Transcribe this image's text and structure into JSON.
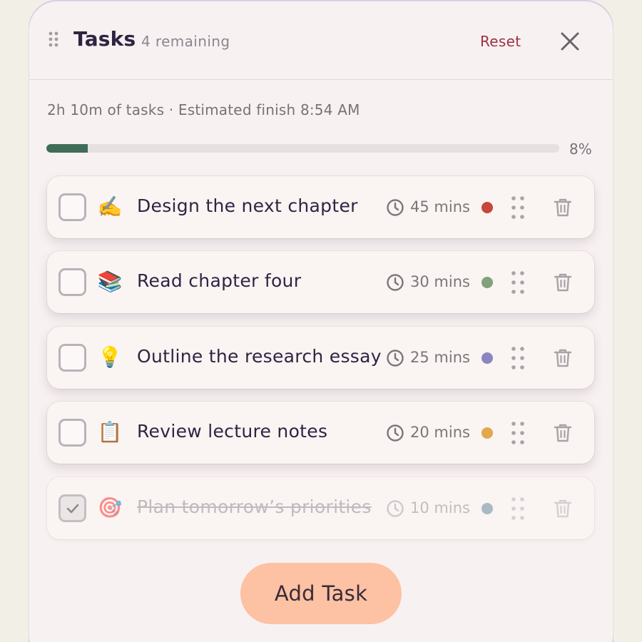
{
  "header": {
    "title": "Tasks",
    "remaining": "4 remaining",
    "reset_label": "Reset"
  },
  "summary": {
    "text": "2h 10m of tasks · Estimated finish 8:54 AM"
  },
  "progress": {
    "percent": 8,
    "label": "8%",
    "color": "#3f6d58"
  },
  "tasks": [
    {
      "emoji": "✍️",
      "name": "Design the next chapter",
      "duration": "45 mins",
      "color": "#c6473b",
      "done": false
    },
    {
      "emoji": "📚",
      "name": "Read chapter four",
      "duration": "30 mins",
      "color": "#82a07a",
      "done": false
    },
    {
      "emoji": "💡",
      "name": "Outline the research essay",
      "duration": "25 mins",
      "color": "#8a86bf",
      "done": false
    },
    {
      "emoji": "📋",
      "name": "Review lecture notes",
      "duration": "20 mins",
      "color": "#e2a84a",
      "done": false
    },
    {
      "emoji": "🎯",
      "name": "Plan tomorrow’s priorities",
      "duration": "10 mins",
      "color": "#aab9c3",
      "done": true
    }
  ],
  "actions": {
    "add_task_label": "Add Task"
  },
  "icons": {
    "header_grip": "grip-vertical-icon",
    "close": "close-icon",
    "clock": "clock-icon",
    "drag": "drag-handle-icon",
    "delete": "trash-icon",
    "checkmark": "checkmark-icon"
  }
}
